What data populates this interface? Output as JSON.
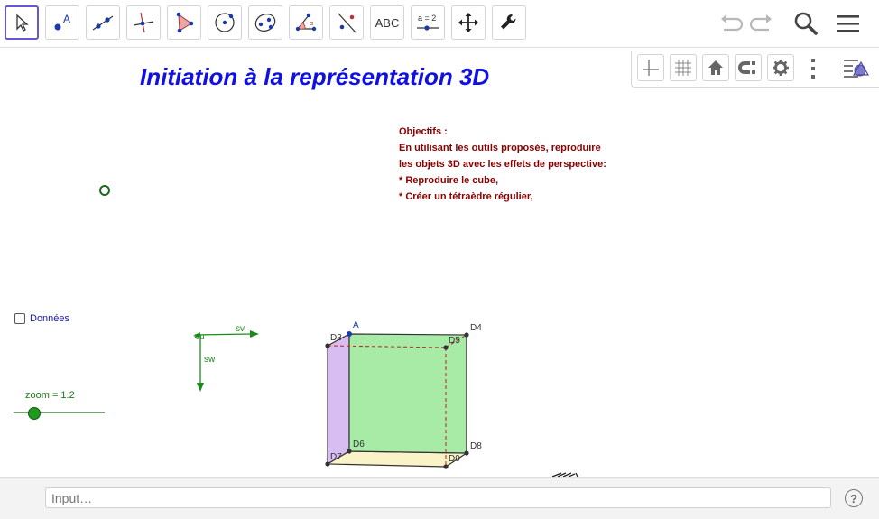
{
  "toolbar": {
    "tools": [
      {
        "name": "move-tool",
        "icon": "cursor-arrow-icon"
      },
      {
        "name": "point-tool",
        "icon": "point-icon",
        "label": "A"
      },
      {
        "name": "line-tool",
        "icon": "line-icon"
      },
      {
        "name": "perpendicular-tool",
        "icon": "perpendicular-icon"
      },
      {
        "name": "polygon-tool",
        "icon": "polygon-icon"
      },
      {
        "name": "circle-tool",
        "icon": "circle-center-icon"
      },
      {
        "name": "ellipse-tool",
        "icon": "ellipse-icon"
      },
      {
        "name": "angle-tool",
        "icon": "angle-icon",
        "label": "α"
      },
      {
        "name": "reflect-tool",
        "icon": "reflect-icon"
      },
      {
        "name": "text-tool",
        "icon": "text-icon",
        "label": "ABC"
      },
      {
        "name": "slider-tool",
        "icon": "slider-icon",
        "label": "a = 2"
      },
      {
        "name": "move-graphics-tool",
        "icon": "move-view-icon"
      },
      {
        "name": "settings-tool",
        "icon": "wrench-icon"
      }
    ],
    "undo_icon": "undo-icon",
    "redo_icon": "redo-icon",
    "search_icon": "search-icon",
    "menu_icon": "menu-icon"
  },
  "style_bar": {
    "buttons": [
      "axes-icon",
      "grid-icon",
      "home-icon",
      "magnet-icon",
      "gear-icon",
      "more-vertical-icon",
      "style-bar-toggle-icon"
    ]
  },
  "canvas": {
    "title": "Initiation à la représentation 3D",
    "objectives": [
      "Objectifs :",
      "En utilisant les outils proposés, reproduire",
      "les objets 3D avec les effets de perspective:",
      "* Reproduire le cube,",
      "* Créer un tétraèdre régulier,"
    ],
    "checkbox_label": "Données",
    "zoom_label": "zoom = 1.2",
    "vector_labels": {
      "su": "su",
      "sv": "sv",
      "sw": "sw"
    },
    "point_labels": {
      "A": "A",
      "D3": "D3",
      "D4": "D4",
      "D5": "D5",
      "D6": "D6",
      "D7": "D7",
      "D8": "D8",
      "D9": "D9"
    }
  },
  "input_bar": {
    "placeholder": "Input…",
    "help_label": "?"
  },
  "colors": {
    "title": "#1010e0",
    "objectives": "#8b0000",
    "front_face": "#9ee69e",
    "left_face": "#d5b6f0",
    "bottom_face": "#fbf2c0",
    "active_tool_border": "#6557d2"
  }
}
